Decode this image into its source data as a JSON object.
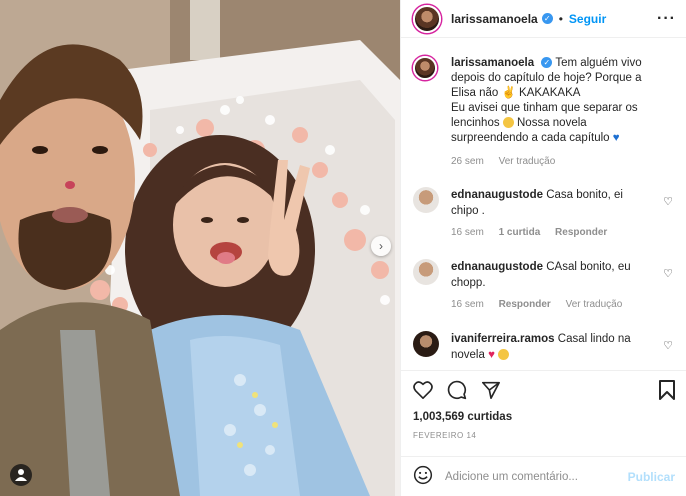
{
  "post": {
    "username": "larissamanoela",
    "follow_label": "Seguir",
    "more_label": "···",
    "caption": {
      "line1": "Tem alguém vivo",
      "line2": "depois do capítulo de hoje? Porque a",
      "line3": "Elisa não",
      "line3_tail": "KAKAKAKA",
      "line4": "Eu avisei que tinham que separar os",
      "line5": "lencinhos",
      "line5_tail": "Nossa novela",
      "line6": "surpreendendo a cada capítulo"
    },
    "caption_meta": {
      "age": "26 sem",
      "translate": "Ver tradução"
    }
  },
  "comments": [
    {
      "user": "ednanaugustode",
      "text_line1": "Casa bonito, ei",
      "text_line2": "chipo .",
      "age": "16 sem",
      "likes": "1 curtida",
      "reply": "Responder",
      "translate": ""
    },
    {
      "user": "ednanaugustode",
      "text_line1": "CAsal bonito, eu",
      "text_line2": "chopp.",
      "age": "16 sem",
      "likes": "",
      "reply": "Responder",
      "translate": "Ver tradução"
    },
    {
      "user": "ivaniferreira.ramos",
      "text_line1": "Casal lindo na",
      "text_line2": "novela"
    }
  ],
  "stats": {
    "likes": "1,003,569 curtidas",
    "date": "Fevereiro 14"
  },
  "composer": {
    "placeholder": "Adicione um comentário...",
    "post_label": "Publicar"
  },
  "icons": {
    "more": "more-icon",
    "verified": "verified-badge-icon",
    "like": "heart-icon",
    "comment": "comment-icon",
    "share": "share-icon",
    "save": "bookmark-icon",
    "emoji": "emoji-icon",
    "next": "chevron-right-icon",
    "tag": "user-tag-icon"
  },
  "colors": {
    "accent": "#0095f6",
    "verified": "#3897f0",
    "muted": "#8e8e8e",
    "heart_emoji": "#e0245e",
    "blue_heart": "#1d6fd1"
  }
}
